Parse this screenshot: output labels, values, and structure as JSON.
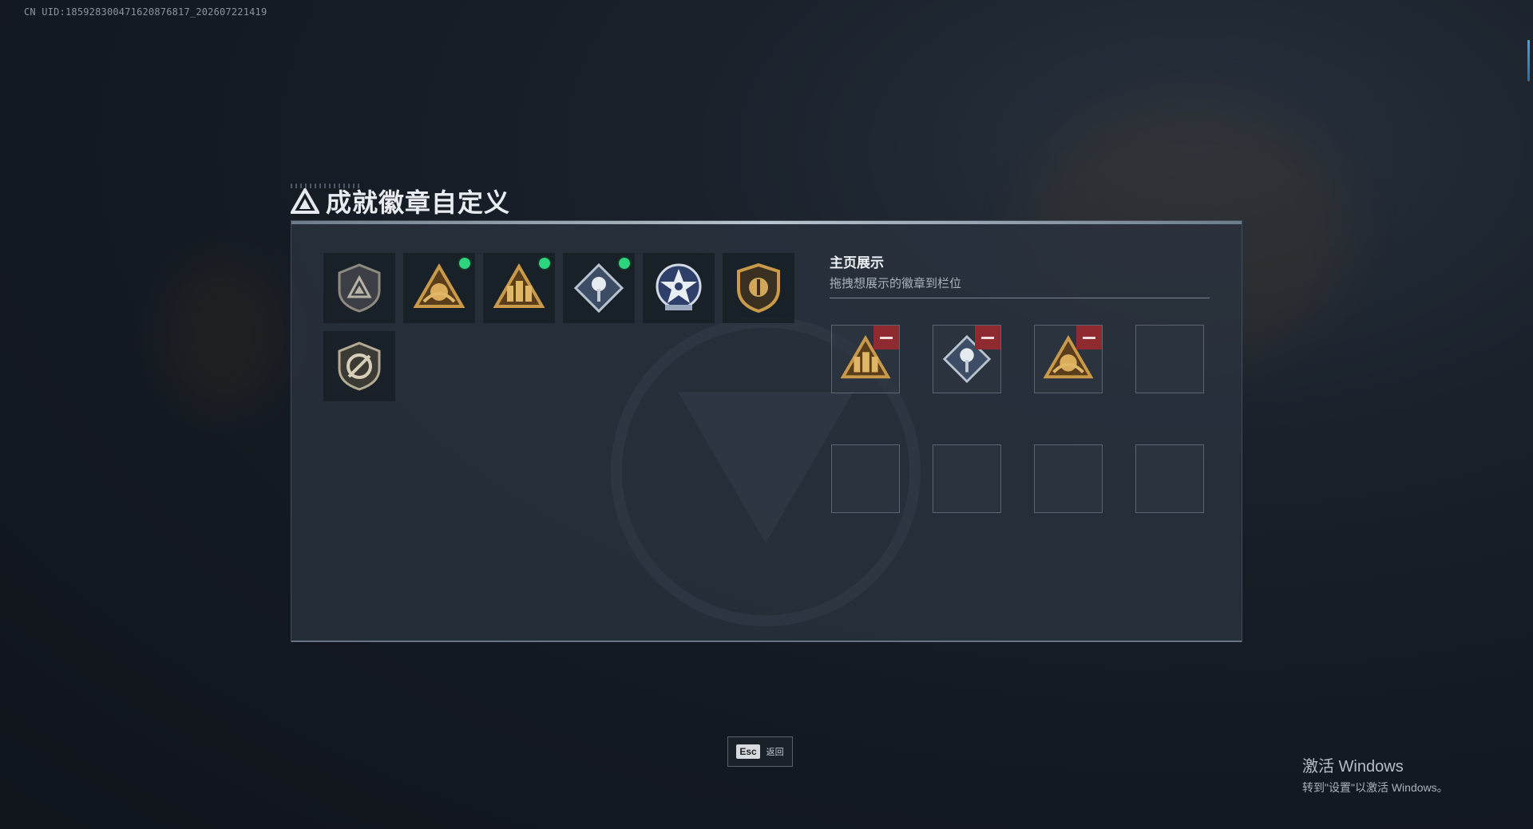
{
  "uid_text": "CN UID:185928300471620876817_202607221419",
  "header": {
    "title": "成就徽章自定义",
    "logo_icon": "triangle-logo-icon"
  },
  "badges": [
    {
      "name": "shield-triangle-badge",
      "new": false
    },
    {
      "name": "gold-triangle-fist-badge",
      "new": true
    },
    {
      "name": "gold-triangle-squad-badge",
      "new": true
    },
    {
      "name": "silver-diamond-rose-badge",
      "new": true
    },
    {
      "name": "blue-star-medal-badge",
      "new": false
    },
    {
      "name": "gold-emblem-shield-badge",
      "new": false
    },
    {
      "name": "slash-shield-badge",
      "new": false
    }
  ],
  "showcase": {
    "title": "主页展示",
    "subtitle": "拖拽想展示的徽章到栏位",
    "slots": [
      {
        "badge": "gold-triangle-squad-badge"
      },
      {
        "badge": "silver-diamond-rose-badge"
      },
      {
        "badge": "gold-triangle-fist-badge"
      },
      {
        "badge": ""
      },
      {
        "badge": ""
      },
      {
        "badge": ""
      },
      {
        "badge": ""
      },
      {
        "badge": ""
      }
    ]
  },
  "footer": {
    "esc_key": "Esc",
    "esc_label": "返回"
  },
  "windows_activation": {
    "line1": "激活 Windows",
    "line2": "转到\"设置\"以激活 Windows。"
  },
  "colors": {
    "new_dot": "#2bd47d",
    "remove_button": "#8f2a30",
    "gold": "#c99a4a"
  }
}
